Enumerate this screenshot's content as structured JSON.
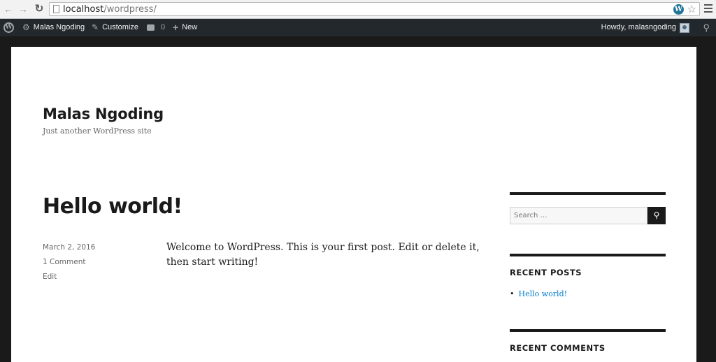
{
  "browser": {
    "url_host": "localhost",
    "url_path": "/wordpress/"
  },
  "adminbar": {
    "site_name": "Malas Ngoding",
    "customize": "Customize",
    "comments_count": "0",
    "new": "New",
    "howdy": "Howdy, malasngoding"
  },
  "site": {
    "title": "Malas Ngoding",
    "description": "Just another WordPress site"
  },
  "post": {
    "title": "Hello world!",
    "date": "March 2, 2016",
    "comments": "1 Comment",
    "edit": "Edit",
    "content": "Welcome to WordPress. This is your first post. Edit or delete it, then start writing!"
  },
  "sidebar": {
    "search_placeholder": "Search …",
    "recent_posts_title": "RECENT POSTS",
    "recent_posts": [
      "Hello world!"
    ],
    "recent_comments_title": "RECENT COMMENTS"
  }
}
